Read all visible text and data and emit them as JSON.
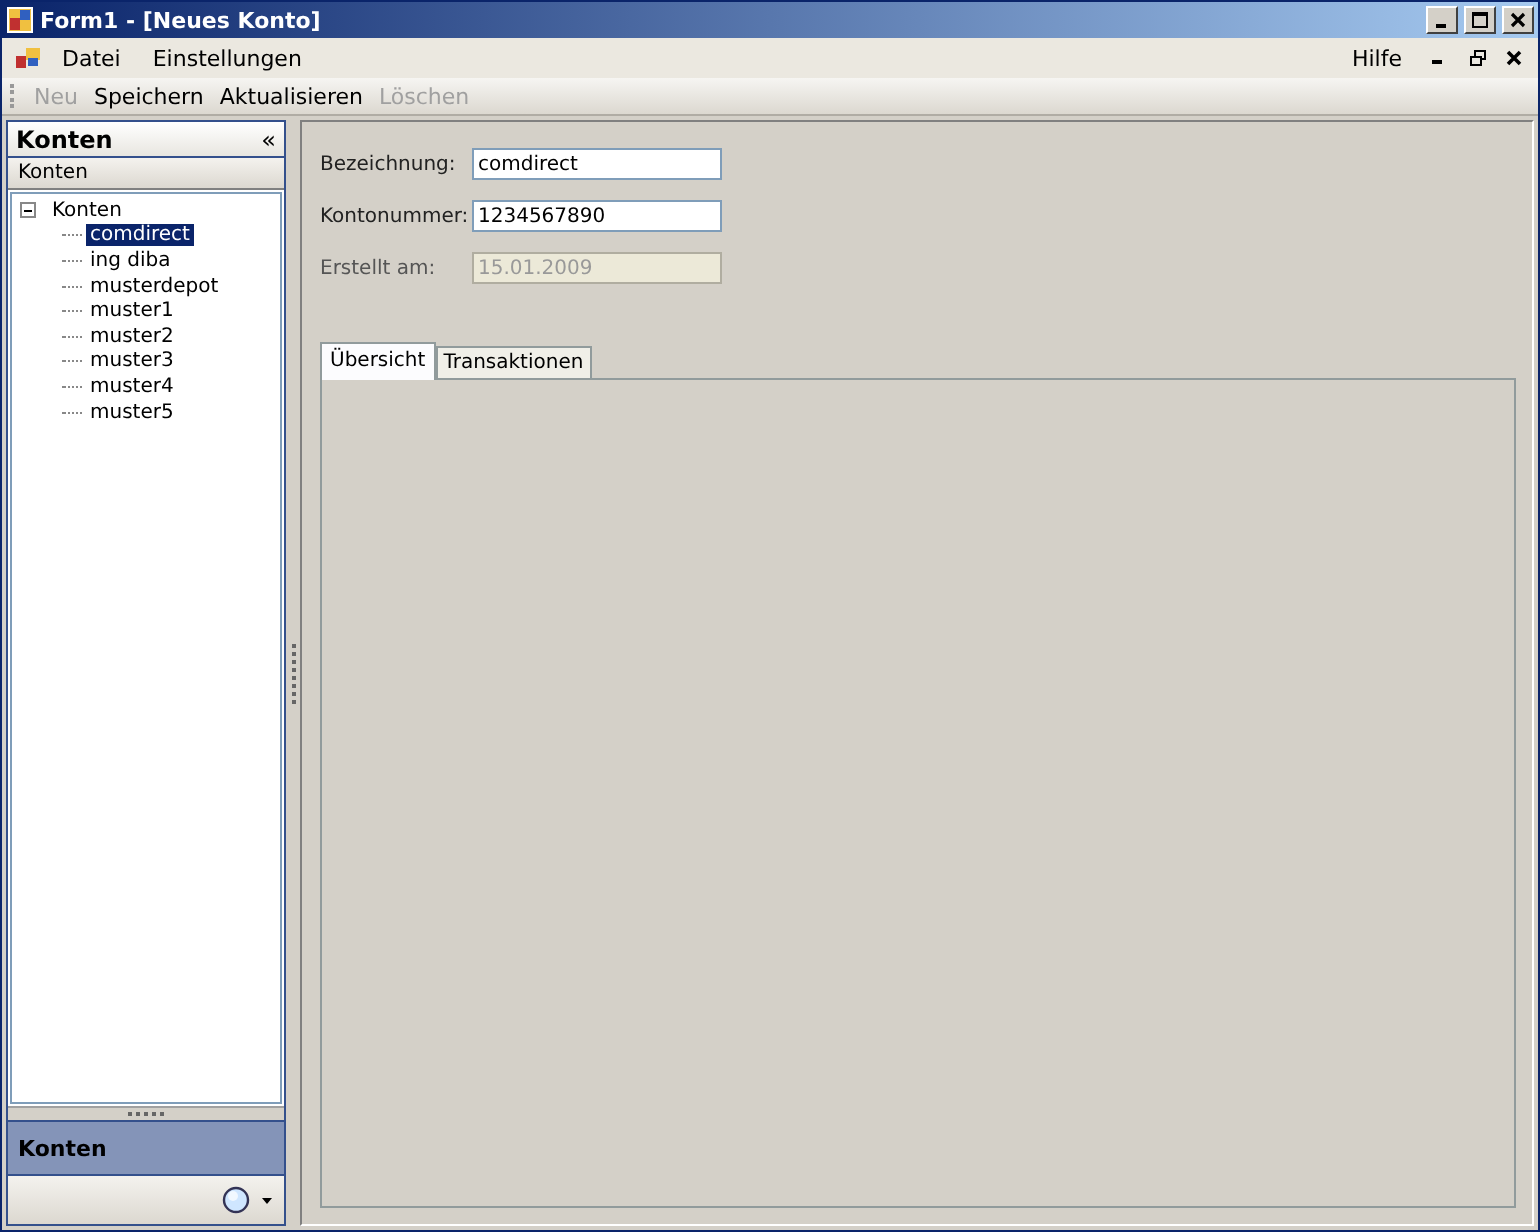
{
  "window": {
    "title": "Form1 - [Neues Konto]"
  },
  "menu": {
    "items": [
      {
        "label": "Datei"
      },
      {
        "label": "Einstellungen"
      }
    ],
    "help": "Hilfe"
  },
  "toolbar": [
    {
      "label": "Neu",
      "disabled": true
    },
    {
      "label": "Speichern",
      "disabled": false
    },
    {
      "label": "Aktualisieren",
      "disabled": false
    },
    {
      "label": "Löschen",
      "disabled": true
    }
  ],
  "sidebar": {
    "title": "Konten",
    "collapse": "«",
    "section": "Konten",
    "tree": {
      "label": "Konten",
      "expanded": true,
      "children": [
        {
          "label": "comdirect",
          "selected": true
        },
        {
          "label": "ing diba",
          "selected": false
        },
        {
          "label": "musterdepot",
          "selected": false
        },
        {
          "label": "muster1",
          "selected": false
        },
        {
          "label": "muster2",
          "selected": false
        },
        {
          "label": "muster3",
          "selected": false
        },
        {
          "label": "muster4",
          "selected": false
        },
        {
          "label": "muster5",
          "selected": false
        }
      ]
    },
    "footer": "Konten"
  },
  "form": {
    "fields": [
      {
        "label": "Bezeichnung:",
        "value": "comdirect",
        "disabled": false
      },
      {
        "label": "Kontonummer:",
        "value": "1234567890",
        "disabled": false
      },
      {
        "label": "Erstellt am:",
        "value": "15.01.2009",
        "disabled": true
      }
    ]
  },
  "tabs": [
    {
      "label": "Übersicht",
      "selected": true
    },
    {
      "label": "Transaktionen",
      "selected": false
    }
  ]
}
